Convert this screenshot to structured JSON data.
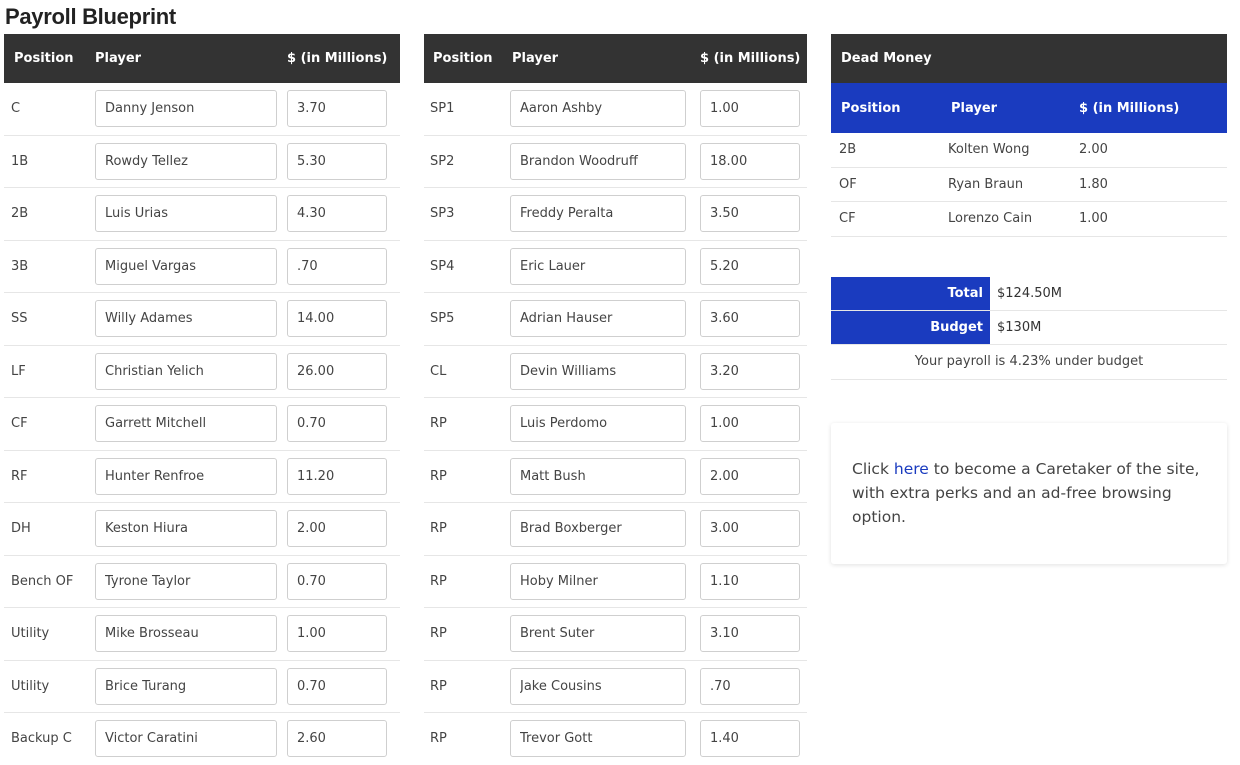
{
  "page": {
    "title": "Payroll Blueprint"
  },
  "headers": {
    "position": "Position",
    "player": "Player",
    "salary": "$ (in Millions)"
  },
  "left_table": [
    {
      "pos": "C",
      "player": "Danny Jenson",
      "salary": "3.70"
    },
    {
      "pos": "1B",
      "player": "Rowdy Tellez",
      "salary": "5.30"
    },
    {
      "pos": "2B",
      "player": "Luis Urias",
      "salary": "4.30"
    },
    {
      "pos": "3B",
      "player": "Miguel Vargas",
      "salary": ".70"
    },
    {
      "pos": "SS",
      "player": "Willy Adames",
      "salary": "14.00"
    },
    {
      "pos": "LF",
      "player": "Christian Yelich",
      "salary": "26.00"
    },
    {
      "pos": "CF",
      "player": "Garrett Mitchell",
      "salary": "0.70"
    },
    {
      "pos": "RF",
      "player": "Hunter Renfroe",
      "salary": "11.20"
    },
    {
      "pos": "DH",
      "player": "Keston Hiura",
      "salary": "2.00"
    },
    {
      "pos": "Bench OF",
      "player": "Tyrone Taylor",
      "salary": "0.70"
    },
    {
      "pos": "Utility",
      "player": "Mike Brosseau",
      "salary": "1.00"
    },
    {
      "pos": "Utility",
      "player": "Brice Turang",
      "salary": "0.70"
    },
    {
      "pos": "Backup C",
      "player": "Victor Caratini",
      "salary": "2.60"
    }
  ],
  "mid_table": [
    {
      "pos": "SP1",
      "player": "Aaron Ashby",
      "salary": "1.00"
    },
    {
      "pos": "SP2",
      "player": "Brandon Woodruff",
      "salary": "18.00"
    },
    {
      "pos": "SP3",
      "player": "Freddy Peralta",
      "salary": "3.50"
    },
    {
      "pos": "SP4",
      "player": "Eric Lauer",
      "salary": "5.20"
    },
    {
      "pos": "SP5",
      "player": "Adrian Hauser",
      "salary": "3.60"
    },
    {
      "pos": "CL",
      "player": "Devin Williams",
      "salary": "3.20"
    },
    {
      "pos": "RP",
      "player": "Luis Perdomo",
      "salary": "1.00"
    },
    {
      "pos": "RP",
      "player": "Matt Bush",
      "salary": "2.00"
    },
    {
      "pos": "RP",
      "player": "Brad Boxberger",
      "salary": "3.00"
    },
    {
      "pos": "RP",
      "player": "Hoby Milner",
      "salary": "1.10"
    },
    {
      "pos": "RP",
      "player": "Brent Suter",
      "salary": "3.10"
    },
    {
      "pos": "RP",
      "player": "Jake Cousins",
      "salary": ".70"
    },
    {
      "pos": "RP",
      "player": "Trevor Gott",
      "salary": "1.40"
    }
  ],
  "dead_money": {
    "title": "Dead Money",
    "rows": [
      {
        "pos": "2B",
        "player": "Kolten Wong",
        "salary": "2.00"
      },
      {
        "pos": "OF",
        "player": "Ryan Braun",
        "salary": "1.80"
      },
      {
        "pos": "CF",
        "player": "Lorenzo Cain",
        "salary": "1.00"
      }
    ]
  },
  "totals": {
    "total_label": "Total",
    "total_value": "$124.50M",
    "budget_label": "Budget",
    "budget_value": "$130M",
    "summary": "Your payroll is 4.23% under budget"
  },
  "promo": {
    "before": "Click ",
    "link": "here",
    "after": " to become a Caretaker of the site, with extra perks and an ad-free browsing option."
  },
  "colors": {
    "header_dark": "#333333",
    "header_blue": "#1a3bbf",
    "link": "#1a3bbf"
  }
}
